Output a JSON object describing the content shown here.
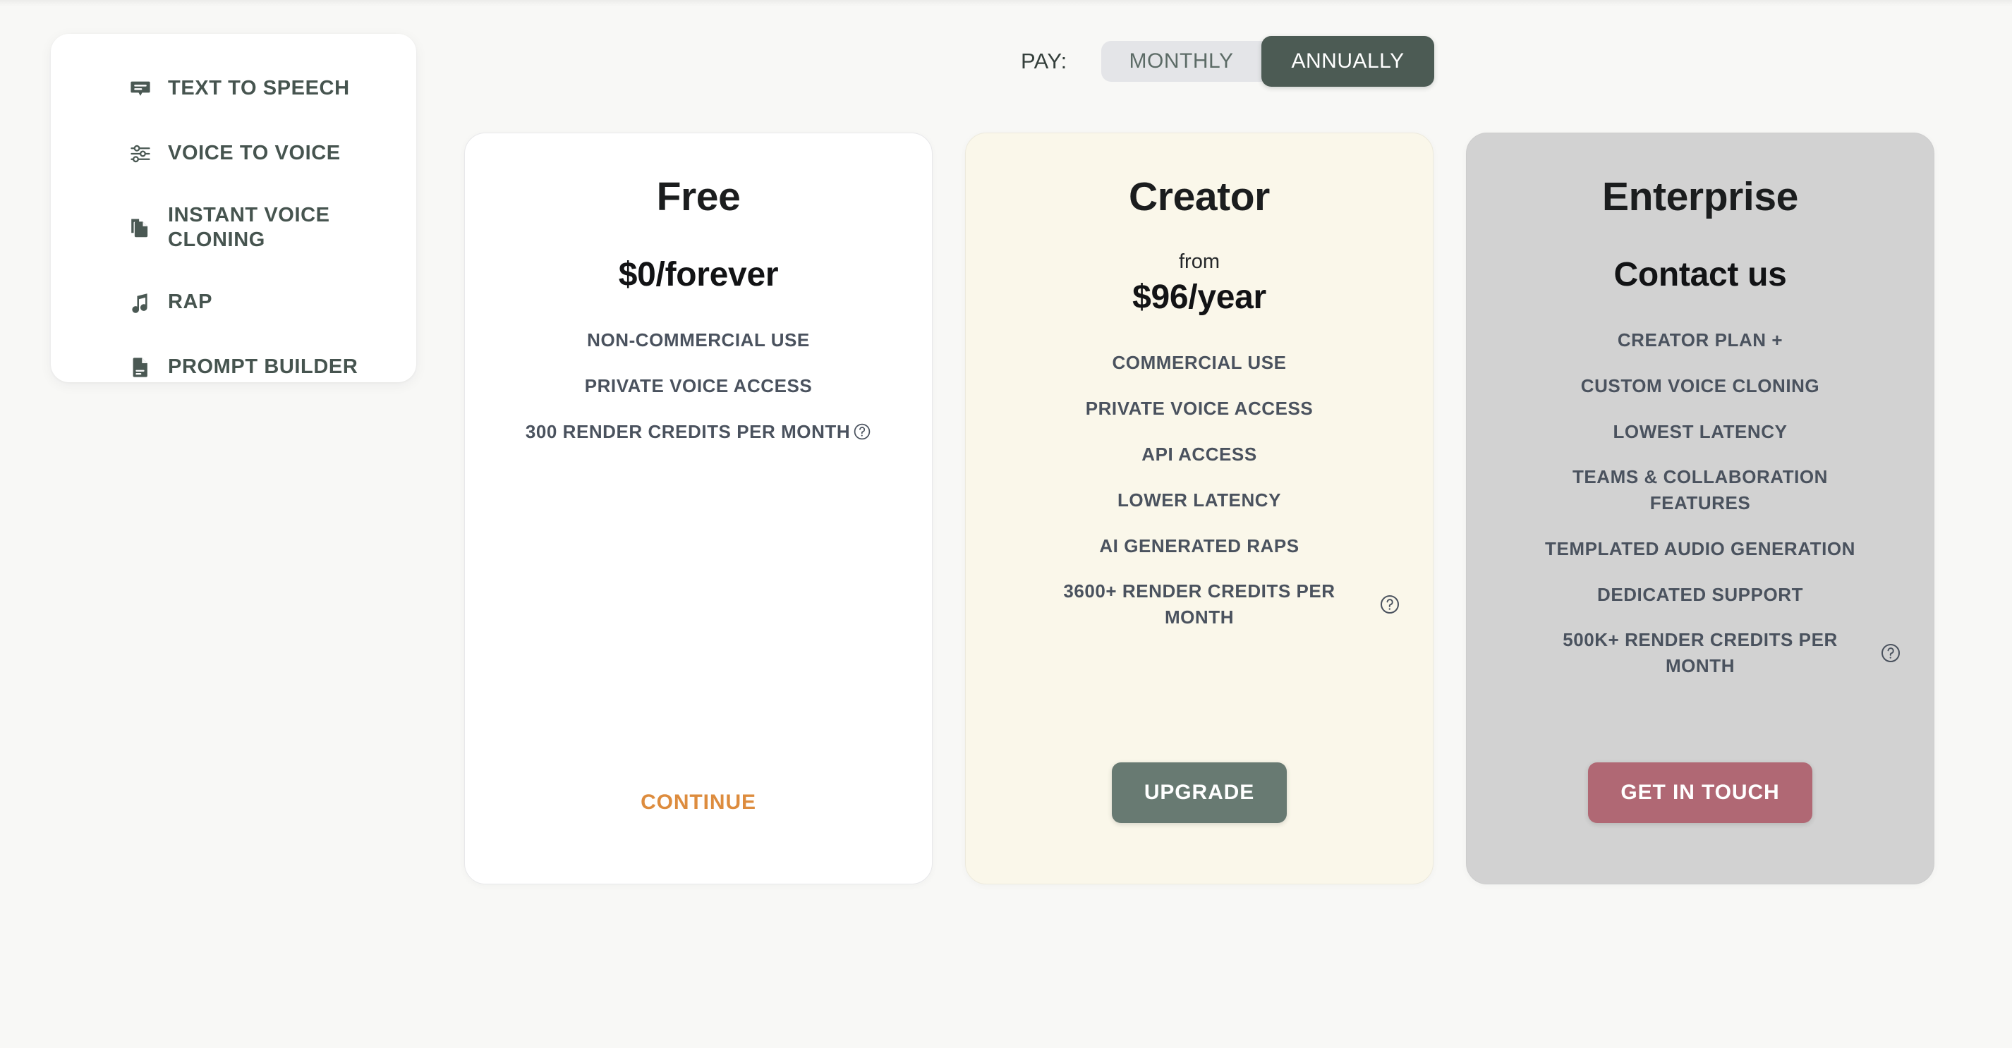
{
  "sidebar": {
    "items": [
      {
        "label": "TEXT TO SPEECH",
        "icon": "speech-bubble-icon"
      },
      {
        "label": "VOICE TO VOICE",
        "icon": "sliders-icon"
      },
      {
        "label": "INSTANT VOICE CLONING",
        "icon": "copy-documents-icon"
      },
      {
        "label": "RAP",
        "icon": "music-note-icon"
      },
      {
        "label": "PROMPT BUILDER",
        "icon": "document-icon"
      }
    ]
  },
  "billing_toggle": {
    "label": "PAY:",
    "options": [
      {
        "label": "MONTHLY",
        "active": false
      },
      {
        "label": "ANNUALLY",
        "active": true
      }
    ],
    "selected": "ANNUALLY",
    "active_color": "#4c5b54",
    "track_color": "#e4e5e8"
  },
  "plans": [
    {
      "name": "Free",
      "price_prefix": "",
      "price": "$0/forever",
      "bg_color": "#ffffff",
      "features": [
        {
          "text": "NON-COMMERCIAL USE",
          "help": false
        },
        {
          "text": "PRIVATE VOICE ACCESS",
          "help": false
        },
        {
          "text": "300 RENDER CREDITS PER MONTH",
          "help": true,
          "help_style": "inline"
        }
      ],
      "cta": {
        "label": "CONTINUE",
        "style": "link",
        "color": "#dd8c3e"
      }
    },
    {
      "name": "Creator",
      "price_prefix": "from",
      "price": "$96/year",
      "bg_color": "#faf7ea",
      "features": [
        {
          "text": "COMMERCIAL USE",
          "help": false
        },
        {
          "text": "PRIVATE VOICE ACCESS",
          "help": false
        },
        {
          "text": "API ACCESS",
          "help": false
        },
        {
          "text": "LOWER LATENCY",
          "help": false
        },
        {
          "text": "AI GENERATED RAPS",
          "help": false
        },
        {
          "text": "3600+ RENDER CREDITS PER MONTH",
          "help": true,
          "help_style": "side"
        }
      ],
      "cta": {
        "label": "UPGRADE",
        "style": "solid",
        "color": "#687a72"
      }
    },
    {
      "name": "Enterprise",
      "price_prefix": "",
      "price": "Contact us",
      "bg_color": "#d2d2d2",
      "features": [
        {
          "text": "CREATOR PLAN +",
          "help": false
        },
        {
          "text": "CUSTOM VOICE CLONING",
          "help": false
        },
        {
          "text": "LOWEST LATENCY",
          "help": false
        },
        {
          "text": "TEAMS & COLLABORATION FEATURES",
          "help": false
        },
        {
          "text": "TEMPLATED AUDIO GENERATION",
          "help": false
        },
        {
          "text": "DEDICATED SUPPORT",
          "help": false
        },
        {
          "text": "500K+ RENDER CREDITS PER MONTH",
          "help": true,
          "help_style": "side"
        }
      ],
      "cta": {
        "label": "GET IN TOUCH",
        "style": "solid",
        "color": "#b06874"
      }
    }
  ]
}
